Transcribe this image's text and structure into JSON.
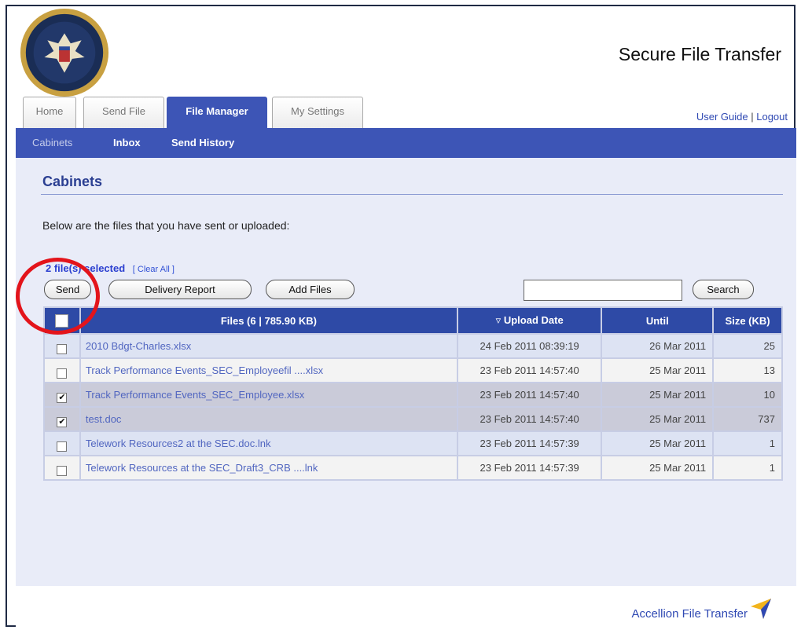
{
  "header": {
    "app_title": "Secure File Transfer"
  },
  "tabs": [
    {
      "label": "Home"
    },
    {
      "label": "Send File"
    },
    {
      "label": "File Manager"
    },
    {
      "label": "My Settings"
    }
  ],
  "top_links": {
    "user_guide": "User Guide",
    "separator": "|",
    "logout": "Logout"
  },
  "subnav": {
    "items": [
      {
        "label": "Cabinets"
      },
      {
        "label": "Inbox"
      },
      {
        "label": "Send History"
      }
    ]
  },
  "main": {
    "title": "Cabinets",
    "intro": "Below are the files that you have sent or uploaded:",
    "selected_count": "2 file(s) selected",
    "clear_all": "[ Clear All ]"
  },
  "toolbar": {
    "send": "Send",
    "delivery_report": "Delivery Report",
    "add_files": "Add Files",
    "search_value": "",
    "search": "Search"
  },
  "table": {
    "headers": {
      "files": "Files (6 | 785.90 KB)",
      "upload_date": "Upload Date",
      "until": "Until",
      "size": "Size (KB)"
    },
    "rows": [
      {
        "checked": false,
        "name": "2010 Bdgt-Charles.xlsx",
        "upload": "24 Feb 2011 08:39:19",
        "until": "26 Mar 2011",
        "size": "25"
      },
      {
        "checked": false,
        "name": "Track Performance Events_SEC_Employeefil ....xlsx",
        "upload": "23 Feb 2011 14:57:40",
        "until": "25 Mar 2011",
        "size": "13"
      },
      {
        "checked": true,
        "name": "Track Performance Events_SEC_Employee.xlsx",
        "upload": "23 Feb 2011 14:57:40",
        "until": "25 Mar 2011",
        "size": "10"
      },
      {
        "checked": true,
        "name": "test.doc",
        "upload": "23 Feb 2011 14:57:40",
        "until": "25 Mar 2011",
        "size": "737"
      },
      {
        "checked": false,
        "name": "Telework Resources2 at the SEC.doc.lnk",
        "upload": "23 Feb 2011 14:57:39",
        "until": "25 Mar 2011",
        "size": "1"
      },
      {
        "checked": false,
        "name": "Telework Resources at the SEC_Draft3_CRB ....lnk",
        "upload": "23 Feb 2011 14:57:39",
        "until": "25 Mar 2011",
        "size": "1"
      }
    ]
  },
  "footer": {
    "brand": "Accellion File Transfer"
  },
  "colors": {
    "nav_blue": "#3d55b6",
    "header_blue": "#2e4aa6",
    "highlight_red": "#e3141b"
  },
  "icons": {
    "seal": "agency-seal-icon",
    "sort": "sort-down-icon",
    "footer_logo": "accellion-arrow-icon"
  }
}
